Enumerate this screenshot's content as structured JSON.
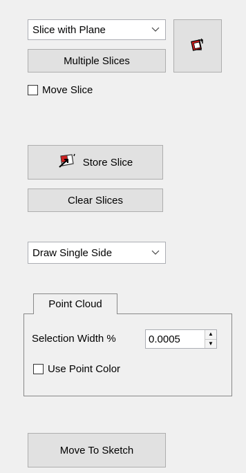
{
  "slice_mode": {
    "selected": "Slice with Plane"
  },
  "buttons": {
    "multiple_slices": "Multiple Slices",
    "store_slice": "Store Slice",
    "clear_slices": "Clear Slices",
    "move_to_sketch": "Move To Sketch"
  },
  "move_slice": {
    "label": "Move Slice",
    "checked": false
  },
  "draw_mode": {
    "selected": "Draw Single Side"
  },
  "point_cloud": {
    "title": "Point Cloud",
    "selection_width_label": "Selection Width %",
    "selection_width_value": "0.0005",
    "use_point_color_label": "Use Point Color",
    "use_point_color_checked": false
  },
  "icons": {
    "flip_icon": "flip-plane-icon",
    "store_icon": "store-slice-icon"
  }
}
